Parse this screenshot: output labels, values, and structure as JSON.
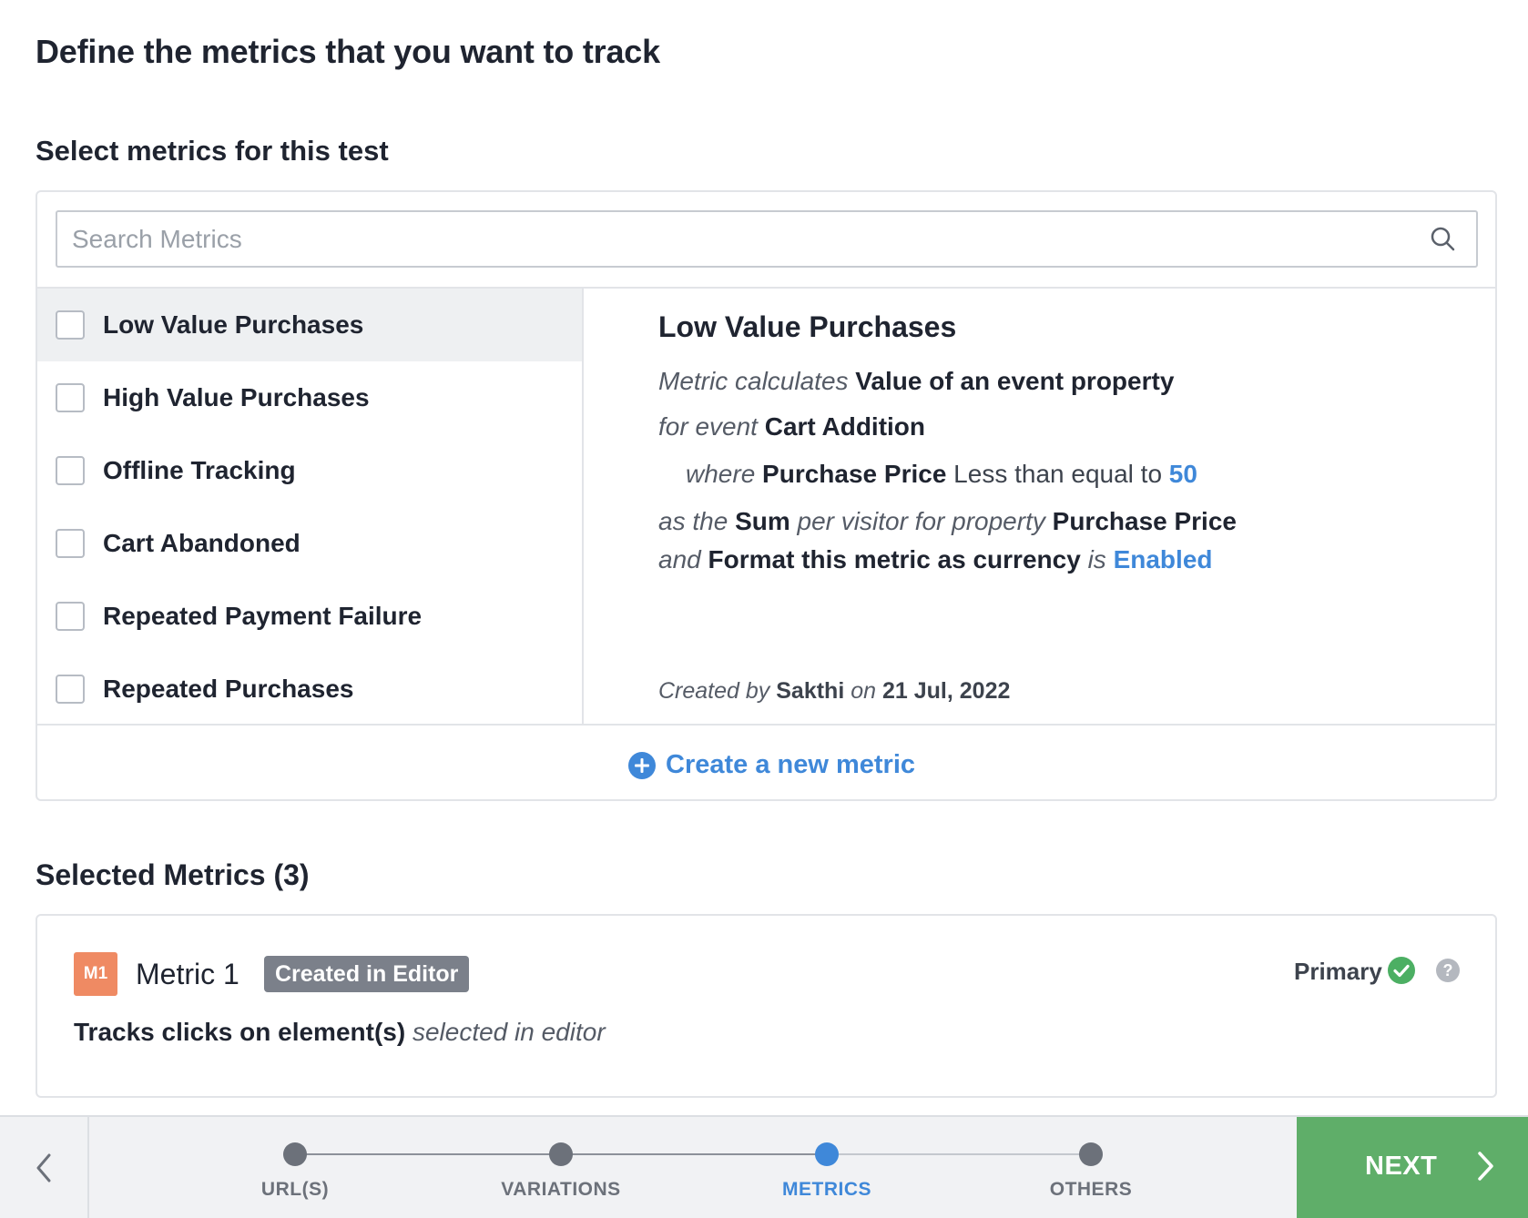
{
  "page": {
    "title": "Define the metrics that you want to track",
    "section_title": "Select metrics for this test"
  },
  "search": {
    "placeholder": "Search Metrics",
    "value": ""
  },
  "metric_list": [
    {
      "label": "Low Value Purchases",
      "checked": false,
      "active": true
    },
    {
      "label": "High Value Purchases",
      "checked": false,
      "active": false
    },
    {
      "label": "Offline Tracking",
      "checked": false,
      "active": false
    },
    {
      "label": "Cart Abandoned",
      "checked": false,
      "active": false
    },
    {
      "label": "Repeated Payment Failure",
      "checked": false,
      "active": false
    },
    {
      "label": "Repeated Purchases",
      "checked": false,
      "active": false
    }
  ],
  "detail": {
    "title": "Low Value Purchases",
    "line1": {
      "prefix": "Metric calculates",
      "value": "Value of an event property"
    },
    "line2": {
      "prefix": "for event",
      "value": "Cart Addition"
    },
    "line3": {
      "prefix": "where",
      "property": "Purchase Price",
      "operator": "Less than equal to",
      "threshold": "50"
    },
    "line4": {
      "prefix": "as the",
      "aggregate": "Sum",
      "middle": "per visitor for property",
      "property": "Purchase Price"
    },
    "line5": {
      "prefix": "and",
      "setting": "Format this metric as currency",
      "middle": "is",
      "status": "Enabled"
    },
    "footer": {
      "created_by_label": "Created by",
      "author": "Sakthi",
      "on_label": "on",
      "date": "21 Jul, 2022"
    }
  },
  "create_link": {
    "label": "Create a new metric",
    "icon": "plus-circle-icon"
  },
  "selected": {
    "title": "Selected Metrics (3)",
    "metric": {
      "badge": "M1",
      "name": "Metric 1",
      "tag": "Created in Editor",
      "primary_label": "Primary",
      "description_bold": "Tracks clicks on element(s)",
      "description_italic": "selected in editor"
    }
  },
  "stepper": {
    "steps": [
      {
        "label": "URL(S)",
        "active": false
      },
      {
        "label": "VARIATIONS",
        "active": false
      },
      {
        "label": "METRICS",
        "active": true
      },
      {
        "label": "OTHERS",
        "active": false
      }
    ],
    "next_label": "NEXT"
  },
  "colors": {
    "accent_blue": "#3f88d9",
    "next_green": "#5fae69",
    "badge_orange": "#ef8a63",
    "check_green": "#4caf63"
  }
}
